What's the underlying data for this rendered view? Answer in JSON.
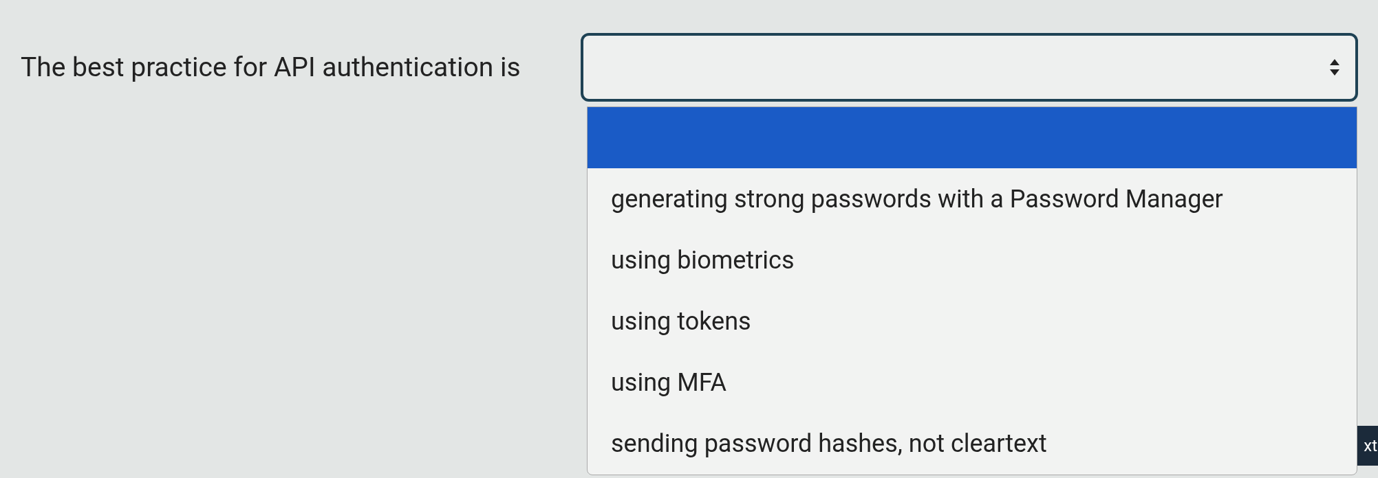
{
  "question": {
    "prompt": "The best practice for API authentication is"
  },
  "select": {
    "expanded": true
  },
  "options": [
    {
      "kind": "blank",
      "selected": true
    },
    {
      "kind": "text",
      "label": "generating strong passwords with a Password Manager",
      "selected": false
    },
    {
      "kind": "text",
      "label": "using biometrics",
      "selected": false
    },
    {
      "kind": "text",
      "label": "using tokens",
      "selected": false
    },
    {
      "kind": "text",
      "label": "using MFA",
      "selected": false
    },
    {
      "kind": "text",
      "label": "sending password hashes, not cleartext",
      "selected": false
    }
  ],
  "next_button": {
    "label": "xt"
  }
}
